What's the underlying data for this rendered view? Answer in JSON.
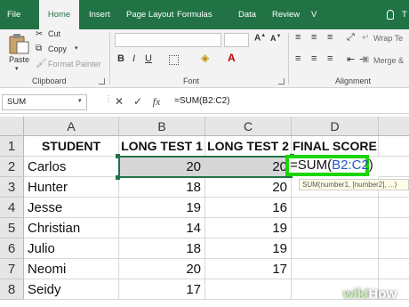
{
  "tabs": [
    "File",
    "Home",
    "Insert",
    "Page Layout",
    "Formulas",
    "Data",
    "Review",
    "V",
    "T"
  ],
  "active_tab": "Home",
  "clipboard": {
    "paste": "Paste",
    "cut": "Cut",
    "copy": "Copy",
    "format_painter": "Format Painter",
    "label": "Clipboard"
  },
  "font_group": {
    "label": "Font"
  },
  "alignment": {
    "wrap_text": "Wrap Te",
    "merge": "Merge &",
    "label": "Alignment"
  },
  "name_box": "SUM",
  "formula_buttons": {
    "cancel": "✕",
    "enter": "✓",
    "fx": "fx"
  },
  "formula_bar_text": "=SUM(B2:C2)",
  "columns": [
    "A",
    "B",
    "C",
    "D"
  ],
  "rows": [
    "1",
    "2",
    "3",
    "4",
    "5",
    "6",
    "7",
    "8"
  ],
  "headers": [
    "STUDENT",
    "LONG TEST 1",
    "LONG TEST 2",
    "FINAL SCORE"
  ],
  "students": [
    {
      "name": "Carlos",
      "t1": "20",
      "t2": "20"
    },
    {
      "name": "Hunter",
      "t1": "18",
      "t2": "20"
    },
    {
      "name": "Jesse",
      "t1": "19",
      "t2": "16"
    },
    {
      "name": "Christian",
      "t1": "14",
      "t2": "19"
    },
    {
      "name": "Julio",
      "t1": "18",
      "t2": "19"
    },
    {
      "name": "Neomi",
      "t1": "20",
      "t2": "17"
    },
    {
      "name": "Seidy",
      "t1": "17",
      "t2": ""
    }
  ],
  "edit_cell": {
    "prefix": "=SUM(",
    "range": "B2:C2",
    "suffix": ")"
  },
  "tooltip": "SUM(number1, [number2], ...)",
  "watermark": {
    "wiki": "wiki",
    "how": "How"
  },
  "colors": {
    "excel_green": "#217346",
    "highlight_green": "#1bd600",
    "range_blue": "#2457c5"
  }
}
